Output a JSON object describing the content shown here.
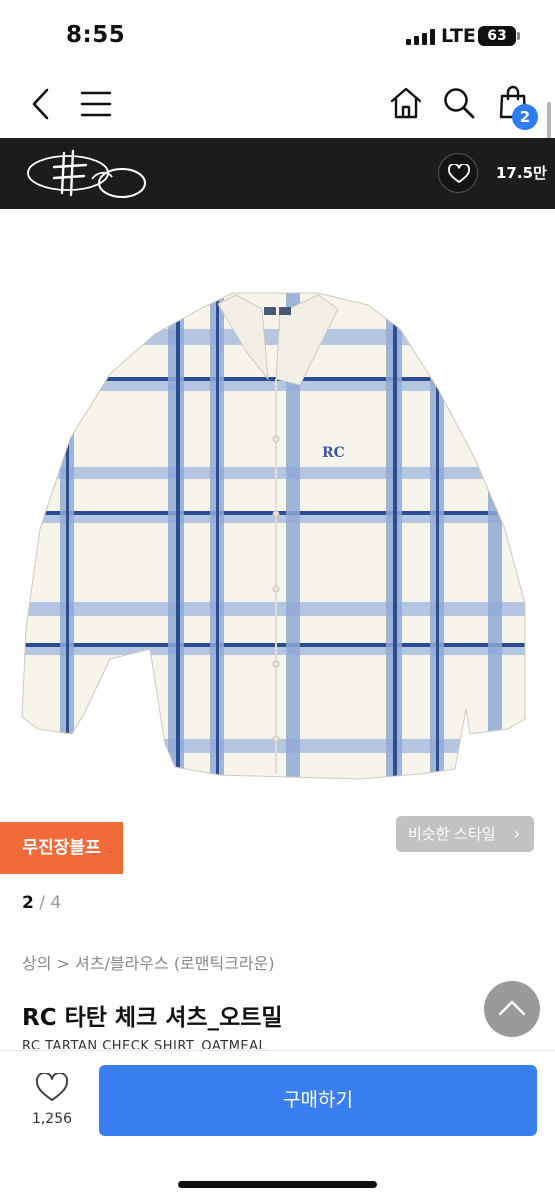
{
  "status_bar": {
    "time": "8:55",
    "network": "LTE",
    "battery": "63"
  },
  "nav": {
    "cart_count": "2"
  },
  "brand": {
    "likes": "17.5만"
  },
  "product": {
    "promo_badge": "무진장블프",
    "similar_style_label": "비슷한 스타일",
    "image_pager": {
      "current": "2",
      "separator": "/",
      "total": "4"
    },
    "breadcrumb": "상의 > 셔츠/블라우스 (로맨틱크라운)",
    "title_ko": "RC 타탄 체크 셔츠_오트밀",
    "title_en": "RC TARTAN CHECK SHIRT_OATMEAL"
  },
  "bottom_bar": {
    "wish_count": "1,256",
    "buy_label": "구매하기"
  },
  "icons": {
    "back": "chevron-left-icon",
    "menu": "hamburger-icon",
    "home": "home-icon",
    "search": "search-icon",
    "cart": "shopping-bag-icon",
    "heart": "heart-icon",
    "scroll_top": "chevron-up-icon"
  },
  "colors": {
    "brand_bar": "#1c1c1c",
    "promo": "#f26a3a",
    "buy_button": "#3a7ff2",
    "badge": "#2f7cf0",
    "shirt_base": "#f7f4ec",
    "check_light": "#7e9dcc",
    "check_dark": "#2c4d90"
  }
}
